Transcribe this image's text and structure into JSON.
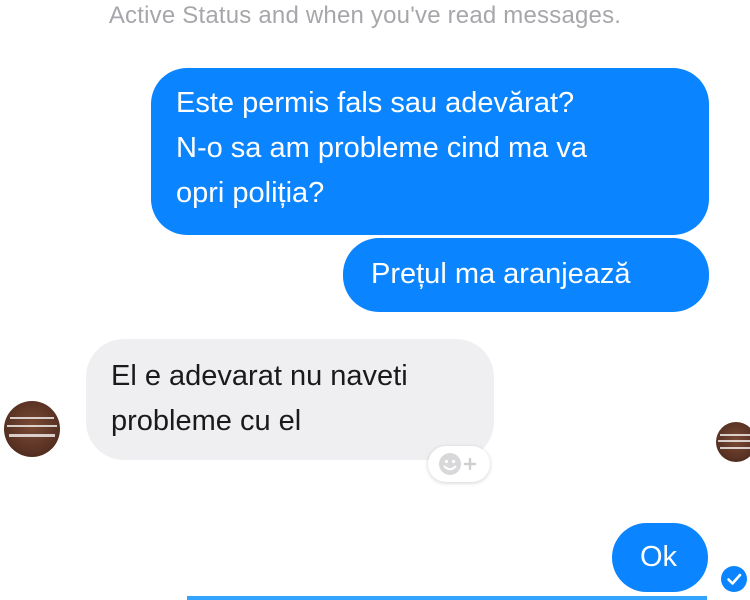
{
  "header": {
    "notice_text": "Active Status and when you've read messages."
  },
  "messages": [
    {
      "direction": "sent",
      "lines": [
        "Este permis fals sau adevărat?",
        "N-o sa am probleme cind ma va",
        "opri poliția?"
      ]
    },
    {
      "direction": "sent",
      "lines": [
        "Prețul ma aranjează"
      ]
    },
    {
      "direction": "received",
      "lines": [
        "El e adevarat nu naveti",
        "probleme cu el"
      ]
    },
    {
      "direction": "sent",
      "lines": [
        "Ok"
      ]
    }
  ],
  "icons": {
    "add_reaction": "smiley-plus-icon",
    "read_receipt": "checkmark-icon",
    "contact_avatar": "avatar"
  },
  "colors": {
    "sent_bubble": "#0a84ff",
    "received_bubble": "#efeff1",
    "notice_text": "#a7a7ab"
  }
}
